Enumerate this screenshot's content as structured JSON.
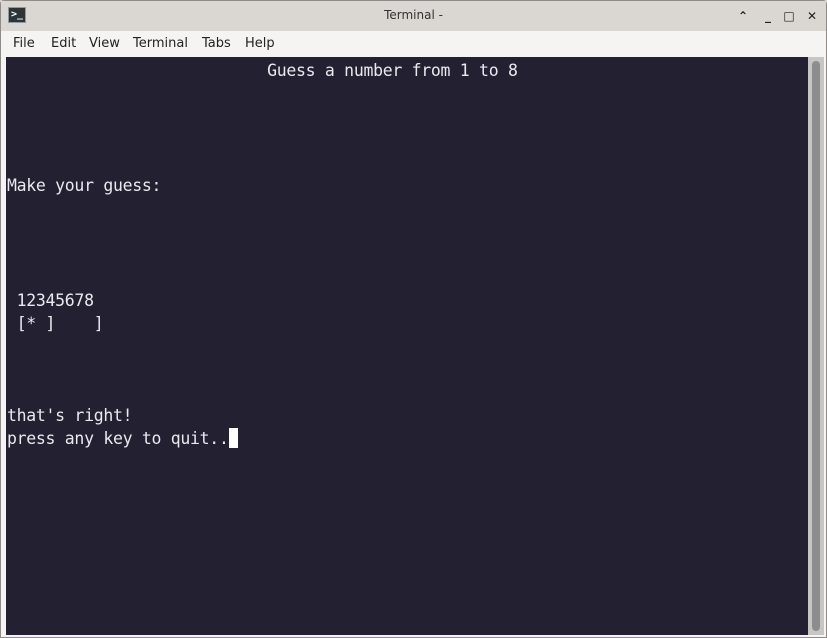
{
  "window": {
    "title": "Terminal -",
    "icon": "terminal-icon",
    "controls": [
      {
        "name": "shade-button",
        "glyph": "⌃"
      },
      {
        "name": "minimize-button",
        "glyph": "_"
      },
      {
        "name": "maximize-button",
        "glyph": "□"
      },
      {
        "name": "close-button",
        "glyph": "✕"
      }
    ]
  },
  "menu": [
    "File",
    "Edit",
    "View",
    "Terminal",
    "Tabs",
    "Help"
  ],
  "terminal": {
    "background": "#232032",
    "foreground": "#e9e9ee",
    "lines": [
      {
        "row": 0,
        "text": "                           Guess a number from 1 to 8"
      },
      {
        "row": 5,
        "text": "Make your guess:"
      },
      {
        "row": 10,
        "text": " 12345678"
      },
      {
        "row": 11,
        "text": " [* ]    ]"
      },
      {
        "row": 15,
        "text": "that's right!"
      },
      {
        "row": 16,
        "text": "press any key to quit.."
      }
    ],
    "cursor_row": 16
  }
}
